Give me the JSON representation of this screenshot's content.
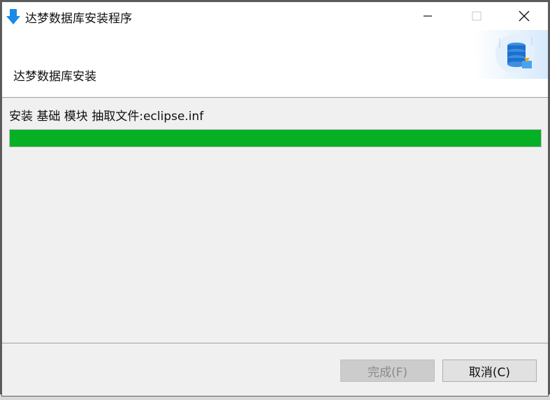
{
  "window": {
    "title": "达梦数据库安装程序",
    "controls": {
      "minimize_icon": "minimize-icon",
      "maximize_icon": "maximize-icon",
      "close_icon": "close-icon"
    }
  },
  "header": {
    "title": "达梦数据库安装",
    "art_icon": "database-install-icon"
  },
  "progress": {
    "status": "安装 基础 模块 抽取文件:eclipse.inf",
    "value": 1.0,
    "color": "#06b025"
  },
  "buttons": {
    "finish_label": "完成(F)",
    "finish_enabled": false,
    "cancel_label": "取消(C)"
  }
}
